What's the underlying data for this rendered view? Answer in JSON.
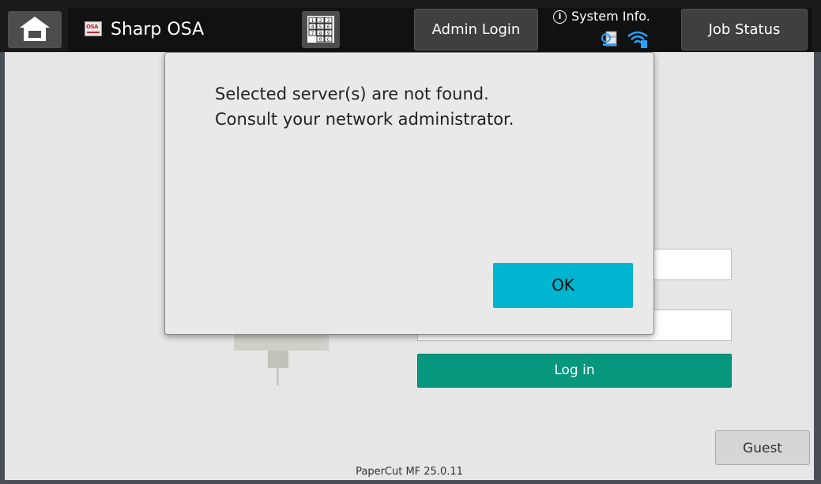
{
  "header": {
    "app_title": "Sharp OSA",
    "osa_icon_text": "OSA",
    "admin_login_label": "Admin Login",
    "system_info_label": "System Info.",
    "job_status_label": "Job Status",
    "icons": [
      "home-icon",
      "osa-app-icon",
      "keypad-icon",
      "info-icon",
      "printer-status-icon",
      "wifi-icon"
    ],
    "keypad_keys": [
      "1",
      "2",
      "3",
      "4",
      "5",
      "6",
      "7",
      "8",
      "9",
      "0",
      "C"
    ]
  },
  "login": {
    "login_label": "Log in",
    "guest_label": "Guest",
    "version_text": "PaperCut MF 25.0.11"
  },
  "dialog": {
    "message_line1": "Selected server(s) are not found.",
    "message_line2": "Consult your network administrator.",
    "ok_label": "OK"
  },
  "colors": {
    "accent_ok": "#00b5cf",
    "login_green": "#07977e",
    "topbar": "#1a1a1a"
  }
}
